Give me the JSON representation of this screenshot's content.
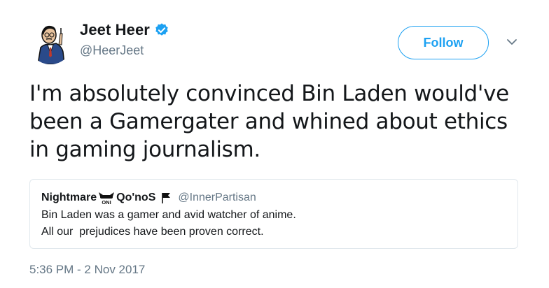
{
  "author": {
    "name": "Jeet Heer",
    "handle": "@HeerJeet",
    "verified": true
  },
  "actions": {
    "follow_label": "Follow",
    "more_icon": "chevron-down-icon"
  },
  "tweet": {
    "text": "I'm absolutely convinced Bin Laden would've been a Gamergater and whined about ethics in gaming journalism.",
    "timestamp": "5:36 PM - 2 Nov 2017"
  },
  "quoted": {
    "name_prefix": "Nightmare",
    "name_suffix": "Qo'noS",
    "emoji_text": "ONI",
    "handle": "@InnerPartisan",
    "line1": "Bin Laden was a gamer and avid watcher of anime.",
    "line2": "All our  prejudices have been proven correct."
  },
  "colors": {
    "accent": "#1da1f2",
    "secondary_text": "#657786",
    "border": "#e1e8ed"
  }
}
